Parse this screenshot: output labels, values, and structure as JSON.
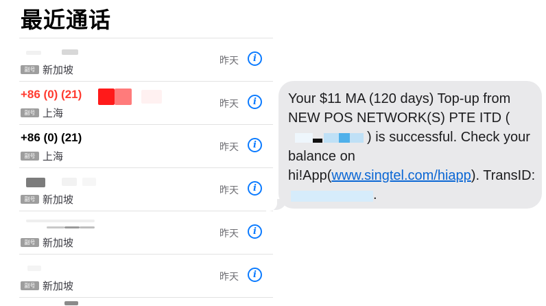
{
  "header": {
    "title": "最近通话"
  },
  "calls": [
    {
      "number": "",
      "missed": false,
      "sim_badge": "副号",
      "location": "新加坡",
      "time": "昨天"
    },
    {
      "number": "+86 (0) (21)",
      "missed": true,
      "sim_badge": "副号",
      "location": "上海",
      "time": "昨天"
    },
    {
      "number": "+86 (0) (21)",
      "missed": false,
      "sim_badge": "副号",
      "location": "上海",
      "time": "昨天"
    },
    {
      "number": "",
      "missed": false,
      "sim_badge": "副号",
      "location": "新加坡",
      "time": "昨天"
    },
    {
      "number": "",
      "missed": false,
      "sim_badge": "副号",
      "location": "新加坡",
      "time": "昨天"
    },
    {
      "number": "",
      "missed": false,
      "sim_badge": "副号",
      "location": "新加坡",
      "time": "昨天"
    }
  ],
  "icons": {
    "info": "info-circle-icon"
  },
  "colors": {
    "accent": "#0a7aff",
    "missed": "#ff3b30",
    "bubble": "#e9e9eb"
  },
  "message": {
    "part1": "Your $11 MA (120 days) Top-up from NEW POS NETWORK(S) PTE ITD (",
    "part2": ") is successful. Check your balance on hi!App(",
    "link": "www.singtel.com/hiapp",
    "part3": "). TransID: ",
    "part4": "."
  }
}
